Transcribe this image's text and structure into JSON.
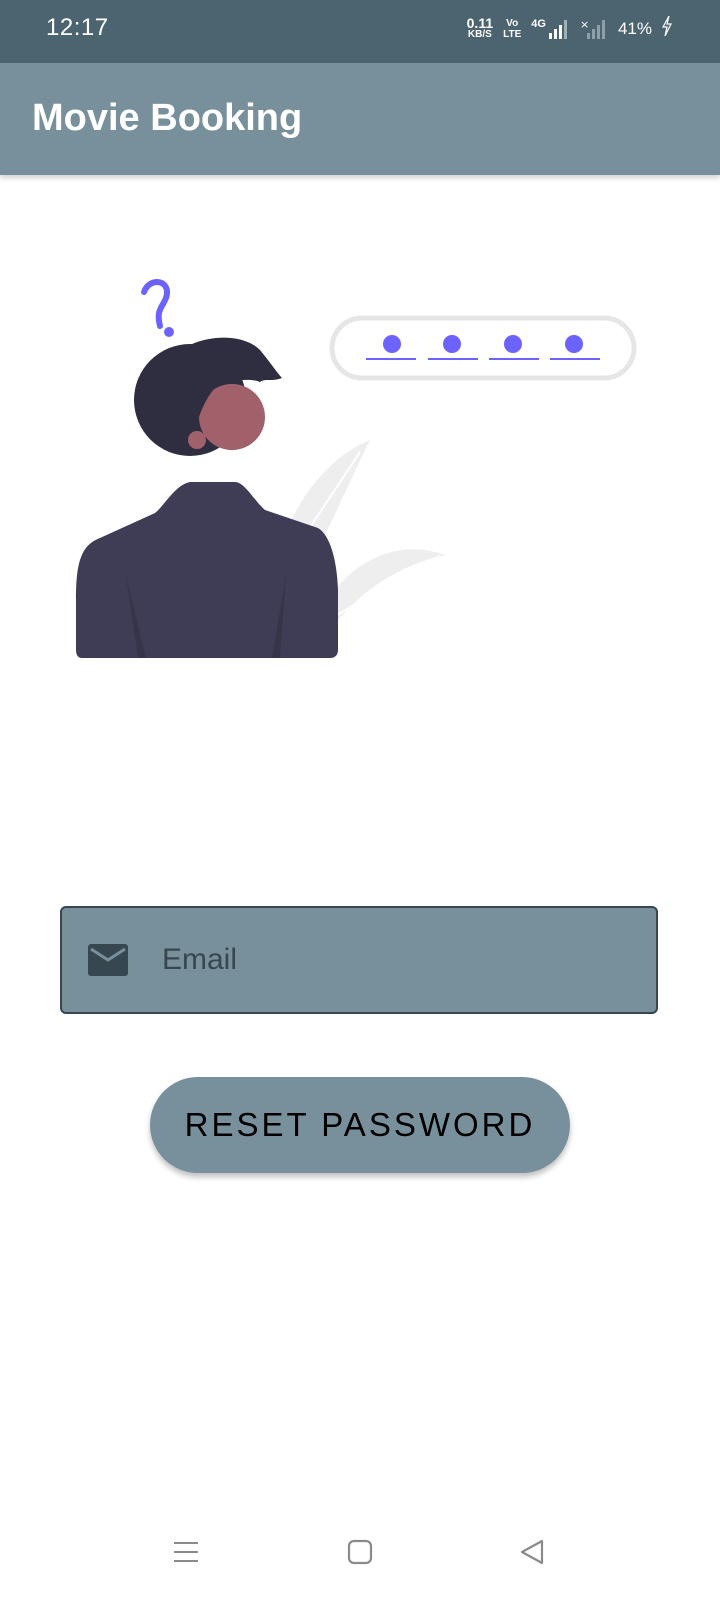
{
  "status_bar": {
    "time": "12:17",
    "net_speed_value": "0.11",
    "net_speed_unit": "KB/S",
    "volte_top": "Vo",
    "volte_bottom": "LTE",
    "network_label": "4G",
    "battery": "41%"
  },
  "app_bar": {
    "title": "Movie Booking"
  },
  "form": {
    "email_placeholder": "Email",
    "reset_button_label": "RESET PASSWORD"
  },
  "colors": {
    "status_bar": "#4c6370",
    "app_bar": "#78909c",
    "accent_purple": "#6c63ff",
    "figure_dark": "#2f2e41",
    "jacket": "#3f3d56",
    "skin": "#a0616a"
  },
  "icons": {
    "email": "mail-icon",
    "nav_menu": "menu-icon",
    "nav_home": "home-icon",
    "nav_back": "back-icon"
  }
}
